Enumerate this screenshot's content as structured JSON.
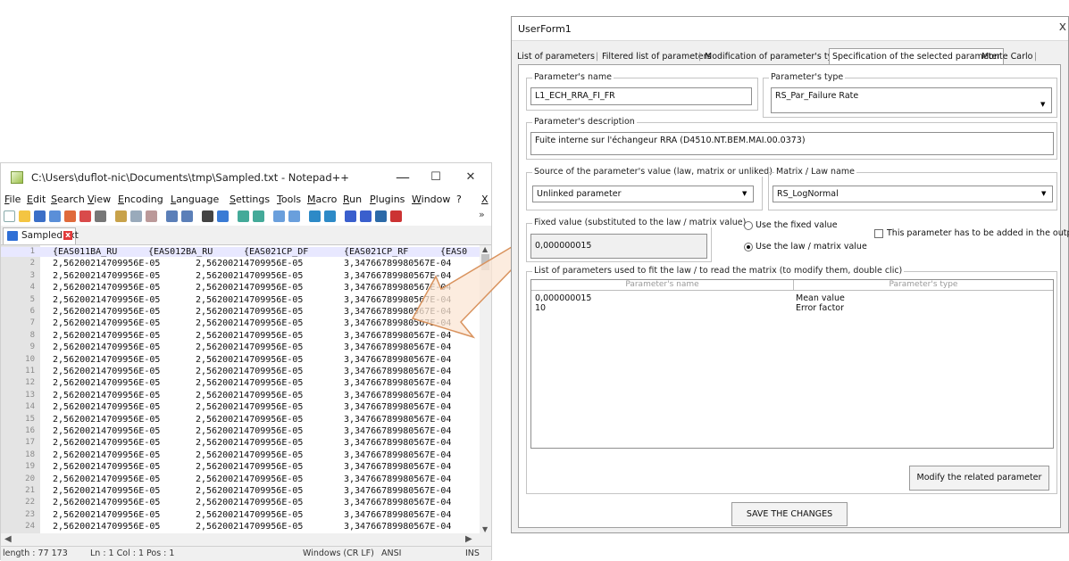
{
  "notepad": {
    "title": "C:\\Users\\duflot-nic\\Documents\\tmp\\Sampled.txt - Notepad++",
    "minimize": "—",
    "maximize": "☐",
    "close": "✕",
    "menu": [
      "File",
      "Edit",
      "Search",
      "View",
      "Encoding",
      "Language",
      "Settings",
      "Tools",
      "Macro",
      "Run",
      "Plugins",
      "Window",
      "?",
      "X"
    ],
    "toolbar_more": "»",
    "tab_label": "Sampled.txt",
    "tab_close": "x",
    "header_row": [
      "{EAS011BA_RU",
      "{EAS012BA_RU",
      "{EAS021CP_DF",
      "{EAS021CP_RF",
      "{EAS0"
    ],
    "data_row": [
      "2,56200214709956E-05",
      "2,56200214709956E-05",
      "3,34766789980567E-04"
    ],
    "line_numbers": [
      "1",
      "2",
      "3",
      "4",
      "5",
      "6",
      "7",
      "8",
      "9",
      "10",
      "11",
      "12",
      "13",
      "14",
      "15",
      "16",
      "17",
      "18",
      "19",
      "20",
      "21",
      "22",
      "23",
      "24"
    ],
    "status": {
      "length": "length : 77 173",
      "pos": "Ln : 1    Col : 1    Pos : 1",
      "eol": "Windows (CR LF)",
      "encoding": "ANSI",
      "mode": "INS"
    }
  },
  "userform": {
    "title": "UserForm1",
    "close": "x",
    "tabs": [
      "List of parameters",
      "Filtered list of parameters",
      "Modification of parameter's types",
      "Specification of the selected parameter",
      "Monte Carlo"
    ],
    "active_tab": "Specification of the selected parameter",
    "param_name_label": "Parameter's name",
    "param_name_value": "L1_ECH_RRA_FI_FR",
    "param_type_label": "Parameter's type",
    "param_type_value": "RS_Par_Failure Rate",
    "param_desc_label": "Parameter's description",
    "param_desc_value": "Fuite interne sur l'échangeur RRA (D4510.NT.BEM.MAI.00.0373)",
    "source_label": "Source of the parameter's value (law, matrix or unliked)",
    "source_value": "Unlinked parameter",
    "matrix_label": "Matrix / Law name",
    "matrix_value": "RS_LogNormal",
    "fixed_label": "Fixed value (substituted to the law / matrix value)",
    "fixed_value": "0,000000015",
    "radio_fixed": "Use the fixed value",
    "radio_law": "Use the law / matrix value",
    "checkbox_output": "This parameter has to be added in the output file",
    "list_label": "List of parameters used to fit the law / to read the matrix (to modify them, double clic)",
    "list_col_name": "Parameter's name",
    "list_col_type": "Parameter's type",
    "list_rows": [
      {
        "name": "0,000000015",
        "type": "Mean value"
      },
      {
        "name": "10",
        "type": "Error factor"
      }
    ],
    "modify_button": "Modify the related parameter",
    "save_button": "SAVE THE CHANGES"
  },
  "colors": {
    "arrow_fill": "#fbe6d4",
    "arrow_stroke": "#d9935e",
    "notepad_gutter": "#e4e4e4"
  }
}
